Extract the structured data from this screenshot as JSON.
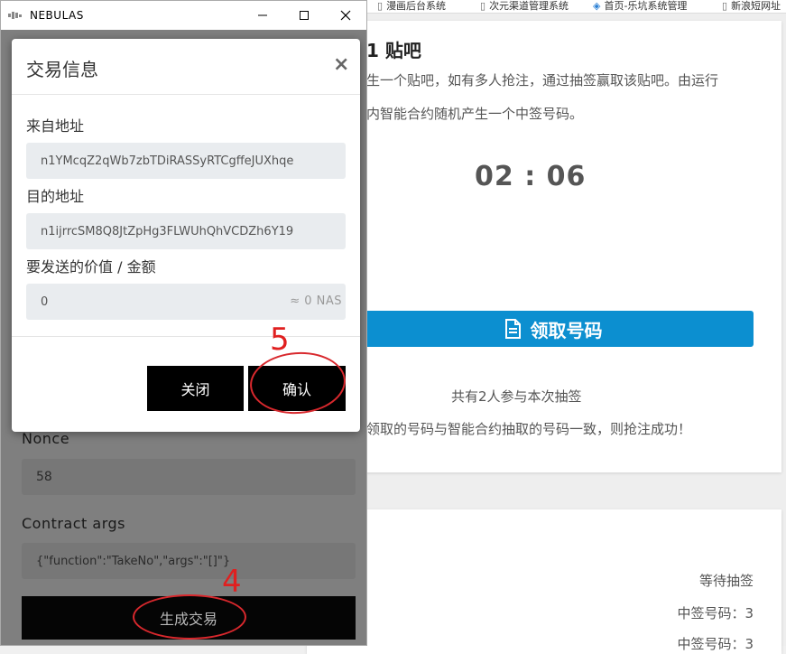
{
  "bookmarks": [
    {
      "label": "漫画后台系统",
      "icon": "page-icon"
    },
    {
      "label": "次元渠道管理系统",
      "icon": "page-icon"
    },
    {
      "label": "首页-乐坑系统管理",
      "icon": "stack-icon"
    },
    {
      "label": "新浪短网址",
      "icon": "page-icon"
    }
  ],
  "page": {
    "title": "1 贴吧",
    "desc_line1": "生一个贴吧，如有多人抢注，通过抽签赢取该贴吧。由运行",
    "desc_line2": "内智能合约随机产生一个中签号码。",
    "timer": "02 : 06",
    "claim_button": "领取号码",
    "participants": "共有2人参与本次抽签",
    "rule": "领取的号码与智能合约抽取的号码一致，则抢注成功！",
    "wait_status": "等待抽签",
    "win_number_1": "中签号码：3",
    "win_number_2": "中签号码：3"
  },
  "window": {
    "title": "NEBULAS"
  },
  "extension": {
    "nonce_label": "Nonce",
    "nonce_value": "58",
    "contract_args_label": "Contract args",
    "contract_args_value": "{\"function\":\"TakeNo\",\"args\":\"[]\"}",
    "generate_button": "生成交易"
  },
  "modal": {
    "title": "交易信息",
    "close_x": "×",
    "from_label": "来自地址",
    "from_value": "n1YMcqZ2qWb7zbTDiRASSyRTCgffeJUXhqe",
    "to_label": "目的地址",
    "to_value": "n1ijrrcSM8Q8JtZpHg3FLWUhQhVCDZh6Y19",
    "amount_label": "要发送的价值 / 金额",
    "amount_value": "0",
    "amount_unit": "≈ 0 NAS",
    "close_button": "关闭",
    "confirm_button": "确认"
  },
  "annotations": {
    "step4": "4",
    "step5": "5",
    "color": "#e02020"
  }
}
